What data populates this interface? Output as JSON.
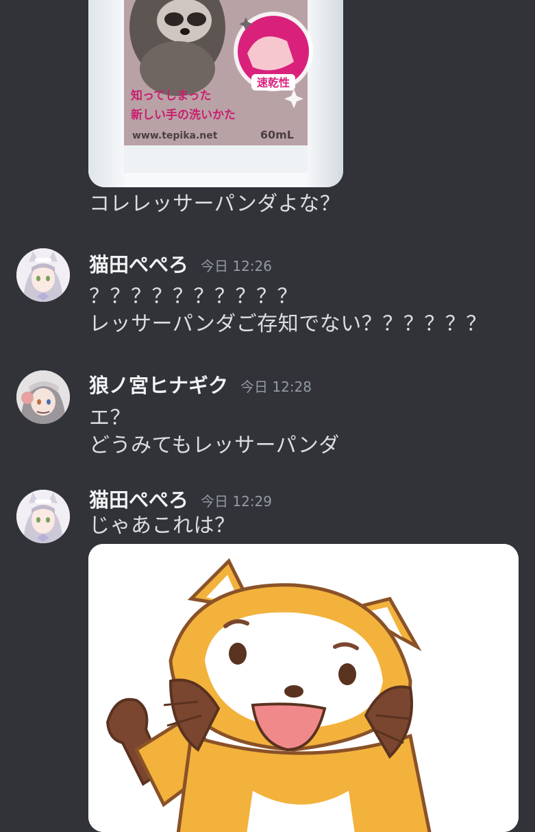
{
  "messages": [
    {
      "id": "msg-0",
      "attachment": {
        "kind": "image",
        "label_line1": "知ってしまった",
        "label_line2": "新しい手の洗いかた",
        "badge": "速乾性",
        "url_text": "www.tepika.net",
        "volume": "60mL"
      },
      "lines": [
        "コレレッサーパンダよな？"
      ]
    },
    {
      "id": "msg-1",
      "author": "猫田ぺぺろ",
      "timestamp": "今日 12:26",
      "lines": [
        "？？？？？？？？？？",
        "レッサーパンダご存知でない？？？？？？"
      ]
    },
    {
      "id": "msg-2",
      "author": "狼ノ宮ヒナギク",
      "timestamp": "今日 12:28",
      "lines": [
        "エ？",
        "どうみてもレッサーパンダ"
      ]
    },
    {
      "id": "msg-3",
      "author": "猫田ぺぺろ",
      "timestamp": "今日 12:29",
      "lines": [
        "じゃあこれは？"
      ],
      "attachment": {
        "kind": "image"
      }
    }
  ],
  "colors": {
    "background": "#313338",
    "text": "#dbdee1",
    "username": "#f2f3f5",
    "timestamp": "#949ba4"
  }
}
